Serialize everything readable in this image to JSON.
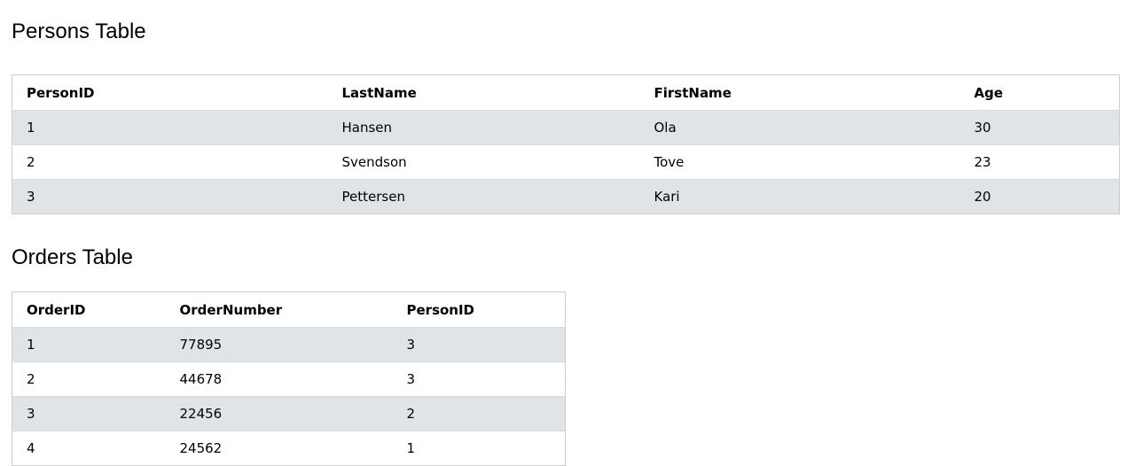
{
  "persons": {
    "title": "Persons Table",
    "headers": [
      "PersonID",
      "LastName",
      "FirstName",
      "Age"
    ],
    "rows": [
      [
        "1",
        "Hansen",
        "Ola",
        "30"
      ],
      [
        "2",
        "Svendson",
        "Tove",
        "23"
      ],
      [
        "3",
        "Pettersen",
        "Kari",
        "20"
      ]
    ]
  },
  "orders": {
    "title": "Orders Table",
    "headers": [
      "OrderID",
      "OrderNumber",
      "PersonID"
    ],
    "rows": [
      [
        "1",
        "77895",
        "3"
      ],
      [
        "2",
        "44678",
        "3"
      ],
      [
        "3",
        "22456",
        "2"
      ],
      [
        "4",
        "24562",
        "1"
      ]
    ]
  }
}
